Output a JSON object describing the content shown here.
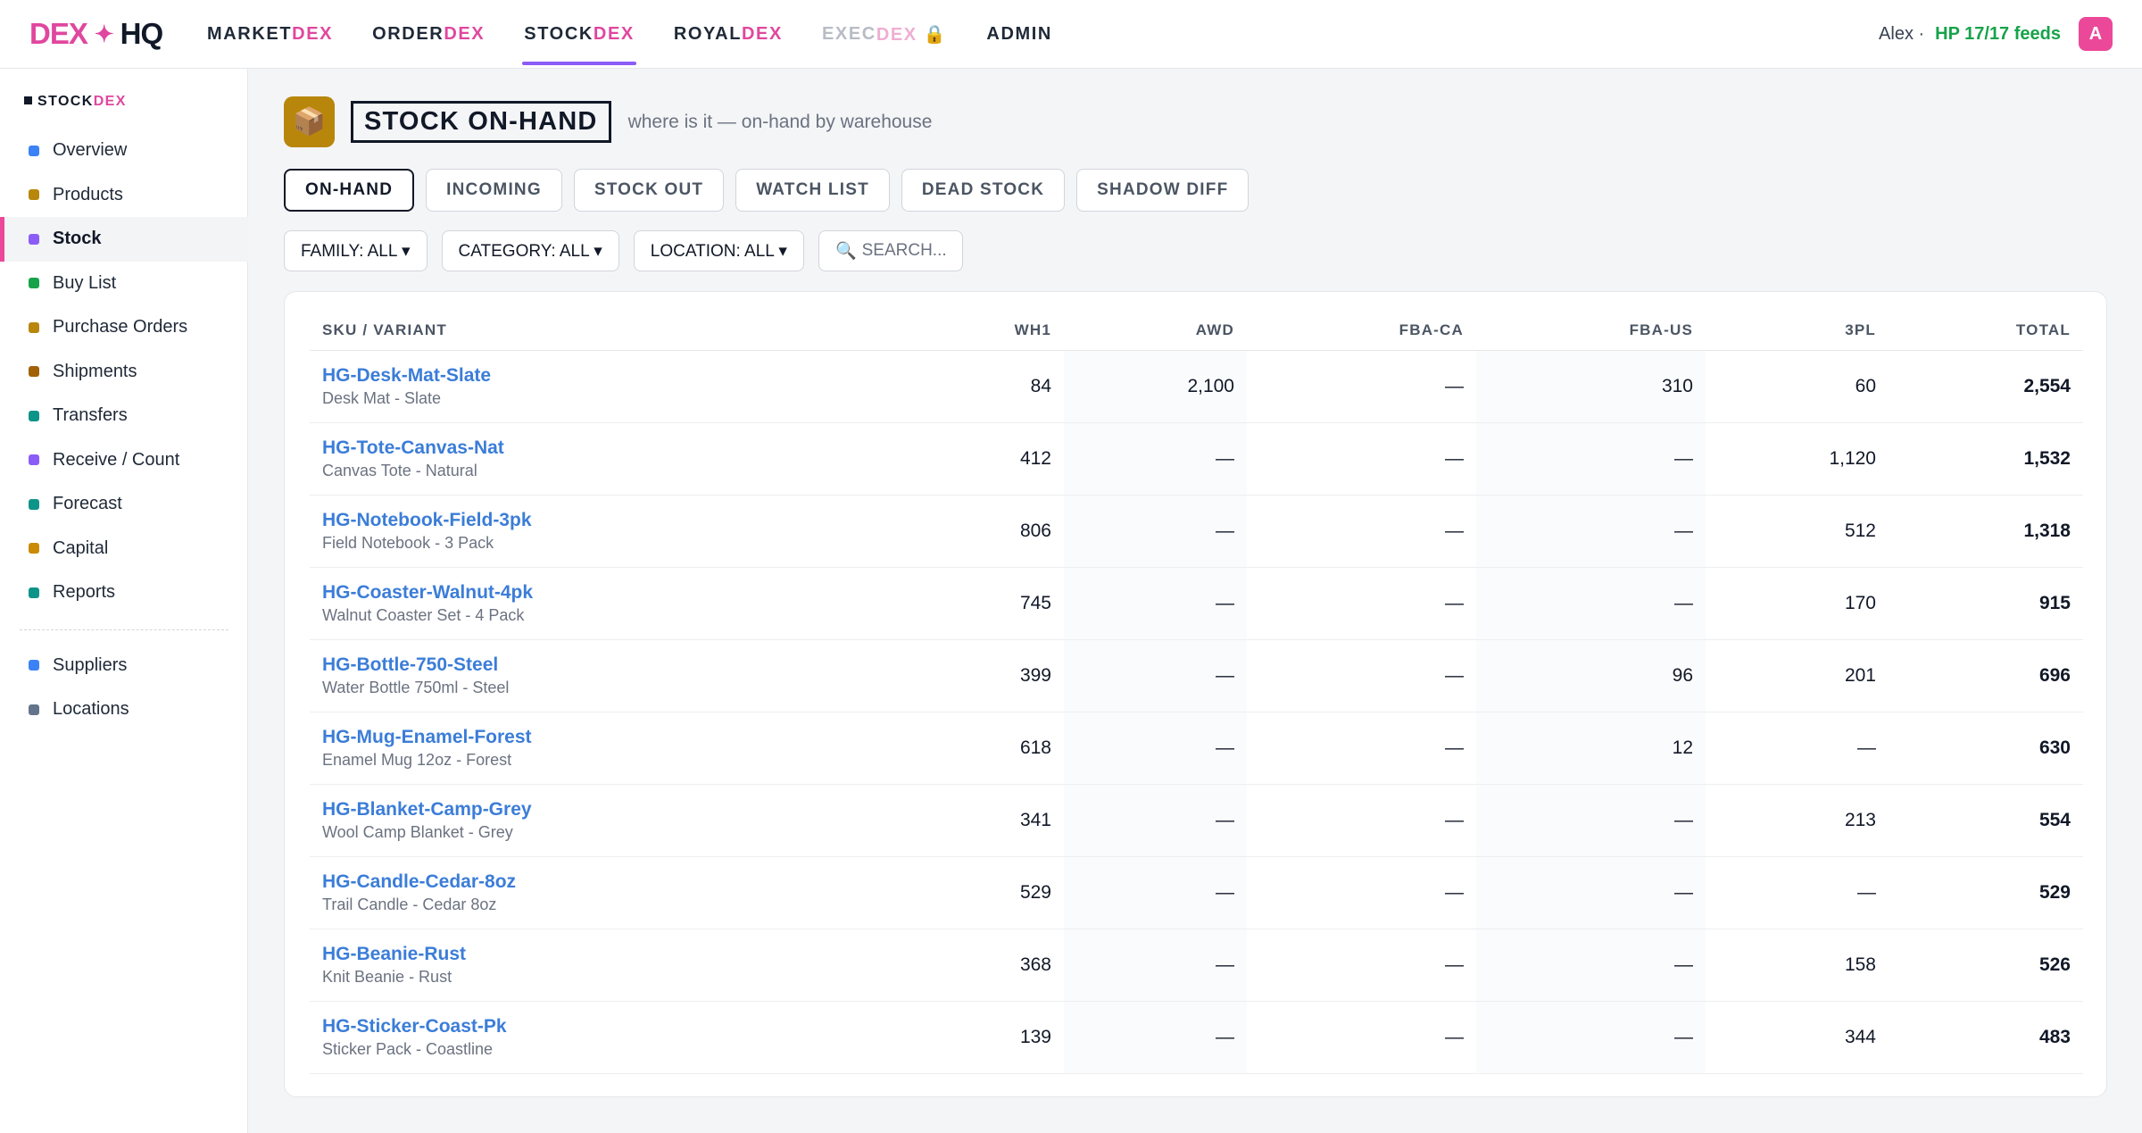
{
  "logo": {
    "dex": "DEX",
    "star": "✦",
    "hq": "HQ"
  },
  "nav": [
    {
      "prefix": "MARKET",
      "suffix": "DEX"
    },
    {
      "prefix": "ORDER",
      "suffix": "DEX"
    },
    {
      "prefix": "STOCK",
      "suffix": "DEX"
    },
    {
      "prefix": "ROYAL",
      "suffix": "DEX"
    },
    {
      "prefix": "EXEC",
      "suffix": "DEX 🔒"
    },
    {
      "prefix": "ADMIN",
      "suffix": ""
    }
  ],
  "user": {
    "name": "Alex ·",
    "feeds": "HP 17/17 feeds",
    "avatar": "A"
  },
  "sidebar": {
    "header": {
      "prefix": "STOCK",
      "suffix": "DEX"
    },
    "items": [
      {
        "label": "Overview",
        "color": "#3b82f6"
      },
      {
        "label": "Products",
        "color": "#b8860b"
      },
      {
        "label": "Stock",
        "color": "#8b5cf6"
      },
      {
        "label": "Buy List",
        "color": "#16a34a"
      },
      {
        "label": "Purchase Orders",
        "color": "#b8860b"
      },
      {
        "label": "Shipments",
        "color": "#a16207"
      },
      {
        "label": "Transfers",
        "color": "#0d9488"
      },
      {
        "label": "Receive / Count",
        "color": "#8b5cf6"
      },
      {
        "label": "Forecast",
        "color": "#0d9488"
      },
      {
        "label": "Capital",
        "color": "#ca8a04"
      },
      {
        "label": "Reports",
        "color": "#0d9488"
      }
    ],
    "secondary": [
      {
        "label": "Suppliers",
        "color": "#3b82f6"
      },
      {
        "label": "Locations",
        "color": "#64748b"
      }
    ]
  },
  "page": {
    "icon": "📦",
    "title": "STOCK ON-HAND",
    "subtitle": "where is it — on-hand by warehouse"
  },
  "tabs": [
    "ON-HAND",
    "INCOMING",
    "STOCK OUT",
    "WATCH LIST",
    "DEAD STOCK",
    "SHADOW DIFF"
  ],
  "filters": [
    "FAMILY: ALL ▾",
    "CATEGORY: ALL ▾",
    "LOCATION: ALL ▾"
  ],
  "search": {
    "icon": "🔍",
    "placeholder": "SEARCH..."
  },
  "table": {
    "columns": [
      "SKU / VARIANT",
      "WH1",
      "AWD",
      "FBA-CA",
      "FBA-US",
      "3PL",
      "TOTAL"
    ],
    "rows": [
      {
        "sku": "HG-Desk-Mat-Slate",
        "desc": "Desk Mat - Slate",
        "wh1": "84",
        "awd": "2,100",
        "fbaca": "—",
        "fbaus": "310",
        "tpl": "60",
        "total": "2,554"
      },
      {
        "sku": "HG-Tote-Canvas-Nat",
        "desc": "Canvas Tote - Natural",
        "wh1": "412",
        "awd": "—",
        "fbaca": "—",
        "fbaus": "—",
        "tpl": "1,120",
        "total": "1,532"
      },
      {
        "sku": "HG-Notebook-Field-3pk",
        "desc": "Field Notebook - 3 Pack",
        "wh1": "806",
        "awd": "—",
        "fbaca": "—",
        "fbaus": "—",
        "tpl": "512",
        "total": "1,318"
      },
      {
        "sku": "HG-Coaster-Walnut-4pk",
        "desc": "Walnut Coaster Set - 4 Pack",
        "wh1": "745",
        "awd": "—",
        "fbaca": "—",
        "fbaus": "—",
        "tpl": "170",
        "total": "915"
      },
      {
        "sku": "HG-Bottle-750-Steel",
        "desc": "Water Bottle 750ml - Steel",
        "wh1": "399",
        "awd": "—",
        "fbaca": "—",
        "fbaus": "96",
        "tpl": "201",
        "total": "696"
      },
      {
        "sku": "HG-Mug-Enamel-Forest",
        "desc": "Enamel Mug 12oz - Forest",
        "wh1": "618",
        "awd": "—",
        "fbaca": "—",
        "fbaus": "12",
        "tpl": "—",
        "total": "630"
      },
      {
        "sku": "HG-Blanket-Camp-Grey",
        "desc": "Wool Camp Blanket - Grey",
        "wh1": "341",
        "awd": "—",
        "fbaca": "—",
        "fbaus": "—",
        "tpl": "213",
        "total": "554"
      },
      {
        "sku": "HG-Candle-Cedar-8oz",
        "desc": "Trail Candle - Cedar 8oz",
        "wh1": "529",
        "awd": "—",
        "fbaca": "—",
        "fbaus": "—",
        "tpl": "—",
        "total": "529"
      },
      {
        "sku": "HG-Beanie-Rust",
        "desc": "Knit Beanie - Rust",
        "wh1": "368",
        "awd": "—",
        "fbaca": "—",
        "fbaus": "—",
        "tpl": "158",
        "total": "526"
      },
      {
        "sku": "HG-Sticker-Coast-Pk",
        "desc": "Sticker Pack - Coastline",
        "wh1": "139",
        "awd": "—",
        "fbaca": "—",
        "fbaus": "—",
        "tpl": "344",
        "total": "483"
      }
    ]
  }
}
